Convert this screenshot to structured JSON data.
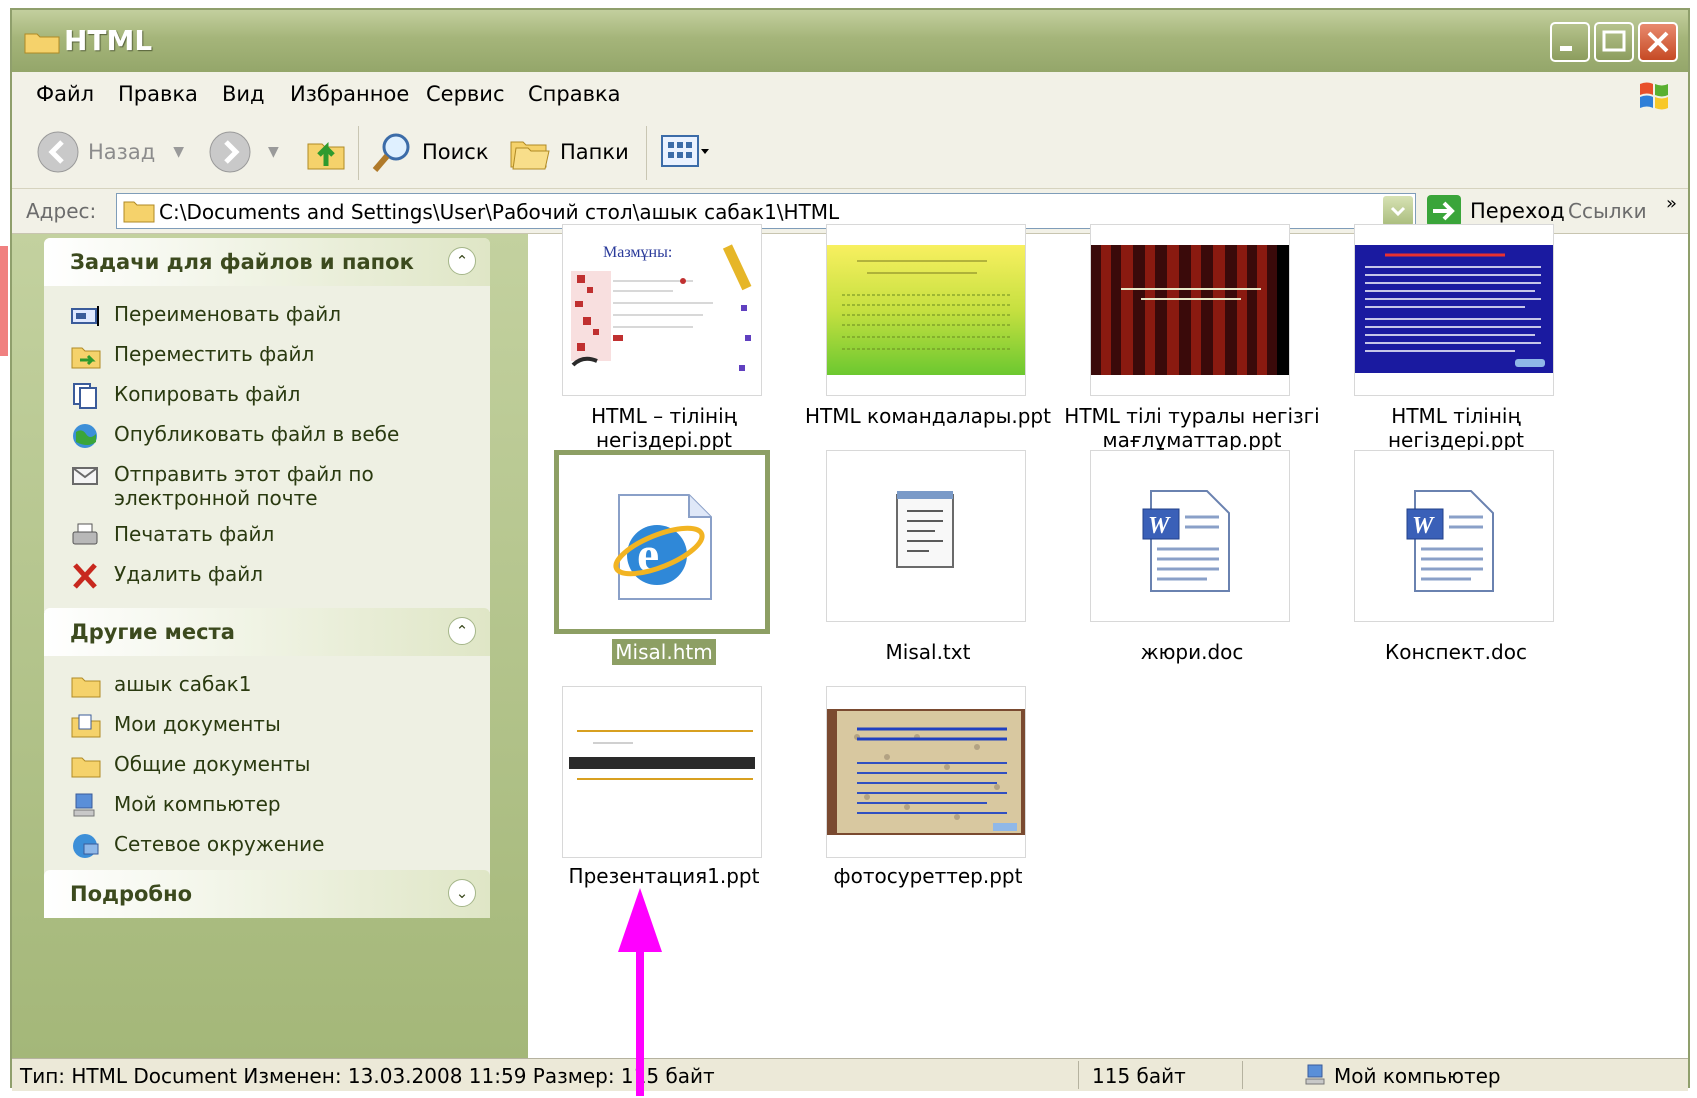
{
  "window": {
    "title": "HTML"
  },
  "menu": [
    "Файл",
    "Правка",
    "Вид",
    "Избранное",
    "Сервис",
    "Справка"
  ],
  "toolbar": {
    "back": "Назад",
    "search": "Поиск",
    "folders": "Папки"
  },
  "address": {
    "label": "Адрес:",
    "path": "C:\\Documents and Settings\\User\\Рабочий стол\\ашык сабак1\\HTML",
    "go": "Переход",
    "links": "Ссылки",
    "links_chevron": "»"
  },
  "tasks_panel": {
    "title": "Задачи для файлов и папок",
    "items": [
      {
        "label": "Переименовать файл",
        "icon": "rename-icon"
      },
      {
        "label": "Переместить файл",
        "icon": "move-icon"
      },
      {
        "label": "Копировать файл",
        "icon": "copy-icon"
      },
      {
        "label": "Опубликовать файл в вебе",
        "icon": "publish-web-icon"
      },
      {
        "label": "Отправить этот файл по электронной почте",
        "icon": "email-icon"
      },
      {
        "label": "Печатать файл",
        "icon": "print-icon"
      },
      {
        "label": "Удалить файл",
        "icon": "delete-icon"
      }
    ]
  },
  "places_panel": {
    "title": "Другие места",
    "items": [
      {
        "label": "ашык сабак1",
        "icon": "folder-icon"
      },
      {
        "label": "Мои документы",
        "icon": "my-documents-icon"
      },
      {
        "label": "Общие документы",
        "icon": "folder-icon"
      },
      {
        "label": "Мой компьютер",
        "icon": "computer-icon"
      },
      {
        "label": "Сетевое окружение",
        "icon": "network-icon"
      }
    ]
  },
  "details_panel": {
    "title": "Подробно"
  },
  "files": [
    {
      "name": "HTML – тілінің негіздері.ppt",
      "line1": "HTML – тілінің",
      "line2": "негіздері.ppt",
      "icon": "ppt-thumbnail"
    },
    {
      "name": "HTML командалары.ppt",
      "line1": "HTML командалары.ppt",
      "line2": "",
      "icon": "ppt-thumbnail"
    },
    {
      "name": "HTML тілі туралы негізгі мағлұматтар.ppt",
      "line1": "HTML тілі туралы негізгі",
      "line2": "мағлұматтар.ppt",
      "icon": "ppt-thumbnail"
    },
    {
      "name": "HTML тілінің негіздері.ppt",
      "line1": "HTML тілінің",
      "line2": "негіздері.ppt",
      "icon": "ppt-thumbnail"
    },
    {
      "name": "Misal.htm",
      "line1": "Misal.htm",
      "line2": "",
      "icon": "ie-html-icon",
      "selected": true
    },
    {
      "name": "Misal.txt",
      "line1": "Misal.txt",
      "line2": "",
      "icon": "notepad-icon"
    },
    {
      "name": "жюри.doc",
      "line1": "жюри.doc",
      "line2": "",
      "icon": "word-doc-icon"
    },
    {
      "name": "Конспект.doc",
      "line1": "Конспект.doc",
      "line2": "",
      "icon": "word-doc-icon"
    },
    {
      "name": "Презентация1.ppt",
      "line1": "Презентация1.ppt",
      "line2": "",
      "icon": "ppt-thumbnail"
    },
    {
      "name": "фотосуреттер.ppt",
      "line1": "фотосуреттер.ppt",
      "line2": "",
      "icon": "ppt-thumbnail"
    }
  ],
  "status": {
    "info": "Тип: HTML Document Изменен: 13.03.2008 11:59 Размер: 115 байт",
    "size": "115 байт",
    "location": "Мой компьютер"
  },
  "colors": {
    "accent": "#8d9f64",
    "pane": "#a4b779",
    "arrow": "#ff00ff"
  }
}
